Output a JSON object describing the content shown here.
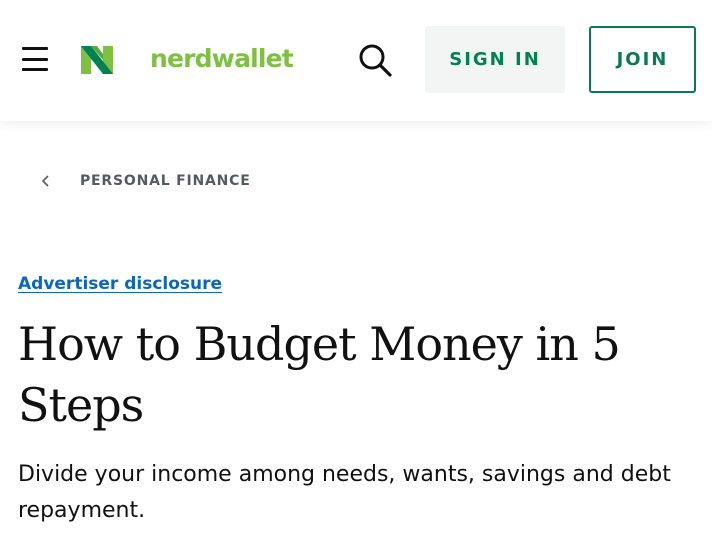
{
  "header": {
    "menu_icon": "hamburger-menu-icon",
    "logo_icon": "nerdwallet-n-logo-icon",
    "logo_text": "nerdwallet",
    "search_icon": "search-icon",
    "sign_in_label": "SIGN IN",
    "join_label": "JOIN"
  },
  "breadcrumb": {
    "icon": "chevron-left-icon",
    "label": "PERSONAL FINANCE"
  },
  "article": {
    "disclosure": "Advertiser disclosure",
    "title": "How to Budget Money in 5 Steps",
    "subtitle": "Divide your income among needs, wants, savings and debt repayment."
  },
  "colors": {
    "brand_green": "#7ec142",
    "brand_dark_green": "#008254",
    "join_green": "#0a7a52",
    "sign_in_bg": "#f3f4f4",
    "link_blue": "#0b66c2",
    "breadcrumb_gray": "#555b5e"
  }
}
